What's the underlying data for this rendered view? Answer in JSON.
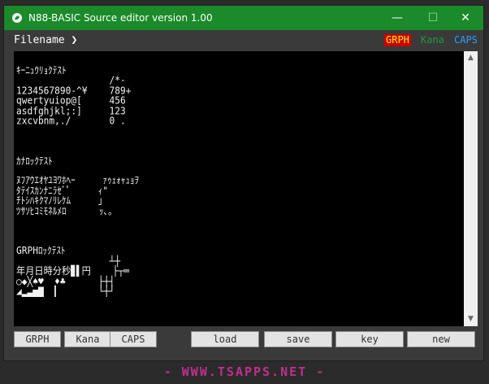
{
  "window": {
    "title": "N88-BASIC Source editor version 1.00",
    "controls": {
      "minimize": "—",
      "maximize": "☐",
      "close": "✕"
    }
  },
  "file_bar": {
    "label": "Filename ❯",
    "indicators": {
      "grph": "GRPH",
      "kana": "Kana",
      "caps": "CAPS"
    }
  },
  "screen": {
    "text": "ｷｰﾆｭｳﾘｮｸﾃｽﾄ\n                 /*-\n1234567890-^¥    789+\nqwertyuiop@[     456\nasdfghjkl;:]     123\nzxcvbnm,./       0 .\n\n\n\nｶﾅﾛｯｸﾃｽﾄ\n\nﾇﾌｱｳｴｵﾔﾕﾖﾜﾎﾍｰ     ｧｩｪｫｬｭｮｦ\nﾀﾃｲｽｶﾝﾅﾆﾗｾﾞﾟ     ｨ\"\nﾁﾄｼﾊｷｸﾏﾉﾘﾚｹﾑ     ｣\nﾂｻｿﾋｺﾐﾓﾈﾙﾒﾛ      ｯ､｡\n\n\n\nGRPHﾛｯｸﾃｽﾄ\n                 ┴┼\n年月日時分秒▊▌円    ├┬═\n○◆╳♠♥  ♦♣      ├┼┤\n◢▂▃▅▇  ▎       └┼┘"
  },
  "buttons": {
    "grph": "GRPH",
    "kana": "Kana",
    "caps": "CAPS",
    "load": "load",
    "save": "save",
    "key": "key",
    "new": "new"
  },
  "footer": {
    "text": "- WWW.TSAPPS.NET -"
  },
  "colors": {
    "titlebar": "#1a8a2a",
    "screen_bg": "#000000",
    "grph_indicator_bg": "#cc0000",
    "grph_indicator_fg": "#ffee00",
    "kana_indicator": "#1e9a3a",
    "caps_indicator": "#2aa0ff",
    "footer": "#c0308c"
  }
}
